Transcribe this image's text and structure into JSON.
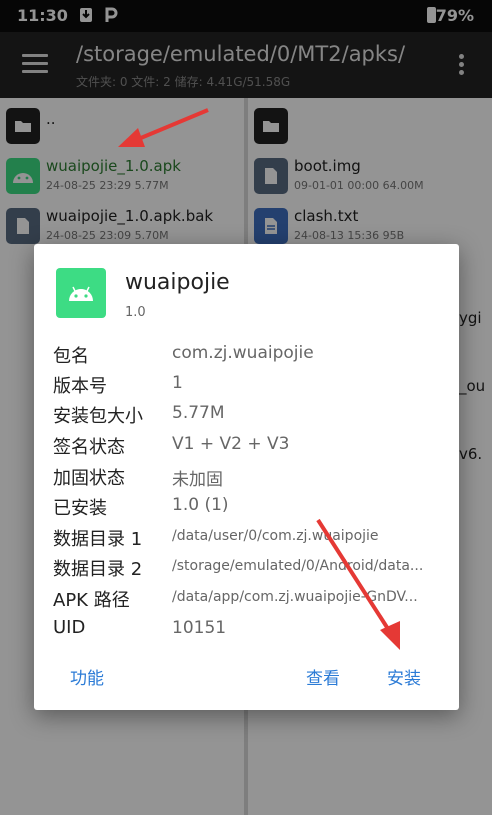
{
  "status_bar": {
    "time": "11:30",
    "battery": "79%"
  },
  "toolbar": {
    "path": "/storage/emulated/0/MT2/apks/",
    "info": "文件夹: 0  文件: 2  储存: 4.41G/51.58G"
  },
  "left_pane": {
    "parent": "..",
    "files": [
      {
        "name": "wuaipojie_1.0.apk",
        "meta": "24-08-25 23:29  5.77M"
      },
      {
        "name": "wuaipojie_1.0.apk.bak",
        "meta": "24-08-25 23:09  5.70M"
      }
    ]
  },
  "right_pane": {
    "files": [
      {
        "name": "boot.img",
        "meta": "09-01-01 00:00  64.00M"
      },
      {
        "name": "clash.txt",
        "meta": "24-08-13 15:36  95B"
      }
    ],
    "partial": [
      "ygi",
      "_ou",
      "v6."
    ]
  },
  "dialog": {
    "app_name": "wuaipojie",
    "app_version": "1.0",
    "info": [
      {
        "label": "包名",
        "value": "com.zj.wuaipojie"
      },
      {
        "label": "版本号",
        "value": "1"
      },
      {
        "label": "安装包大小",
        "value": "5.77M"
      },
      {
        "label": "签名状态",
        "value": "V1 + V2 + V3"
      },
      {
        "label": "加固状态",
        "value": "未加固"
      },
      {
        "label": "已安装",
        "value": "1.0 (1)"
      },
      {
        "label": "数据目录 1",
        "value": "/data/user/0/com.zj.wuaipojie"
      },
      {
        "label": "数据目录 2",
        "value": "/storage/emulated/0/Android/data..."
      },
      {
        "label": "APK 路径",
        "value": "/data/app/com.zj.wuaipojie-GnDV..."
      },
      {
        "label": "UID",
        "value": "10151"
      }
    ],
    "buttons": {
      "function": "功能",
      "view": "查看",
      "install": "安装"
    }
  },
  "colors": {
    "accent": "#2b7bd6",
    "apk_green": "#3ddc84",
    "selected_text": "#2e7d32",
    "arrow": "#e53935"
  }
}
